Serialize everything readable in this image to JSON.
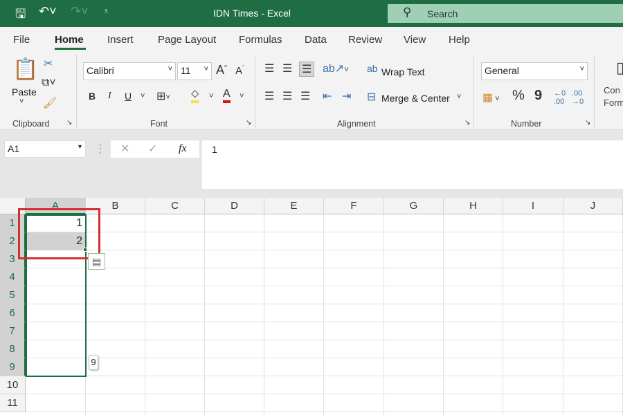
{
  "titlebar": {
    "title": "IDN Times  -  Excel",
    "search_placeholder": "Search"
  },
  "tabs": [
    "File",
    "Home",
    "Insert",
    "Page Layout",
    "Formulas",
    "Data",
    "Review",
    "View",
    "Help"
  ],
  "active_tab": "Home",
  "ribbon": {
    "clipboard": {
      "label": "Clipboard",
      "paste": "Paste"
    },
    "font": {
      "label": "Font",
      "font_name": "Calibri",
      "font_size": "11",
      "bold": "B",
      "italic": "I",
      "underline": "U",
      "font_color": "A"
    },
    "alignment": {
      "label": "Alignment",
      "wrap_text": "Wrap Text",
      "merge_center": "Merge & Center"
    },
    "number": {
      "label": "Number",
      "format": "General",
      "percent": "%",
      "comma": "9"
    },
    "styles": {
      "conditional_formatting": "Con Form"
    }
  },
  "formula_bar": {
    "name_box": "A1",
    "fx": "fx",
    "value": "1"
  },
  "columns": [
    "A",
    "B",
    "C",
    "D",
    "E",
    "F",
    "G",
    "H",
    "I",
    "J"
  ],
  "rows": [
    "1",
    "2",
    "3",
    "4",
    "5",
    "6",
    "7",
    "8",
    "9",
    "10",
    "11"
  ],
  "cells": {
    "A1": "1",
    "A2": "2"
  },
  "fill_tooltip": "9",
  "colors": {
    "accent": "#1f6e43",
    "highlight": "#d32f2f"
  }
}
